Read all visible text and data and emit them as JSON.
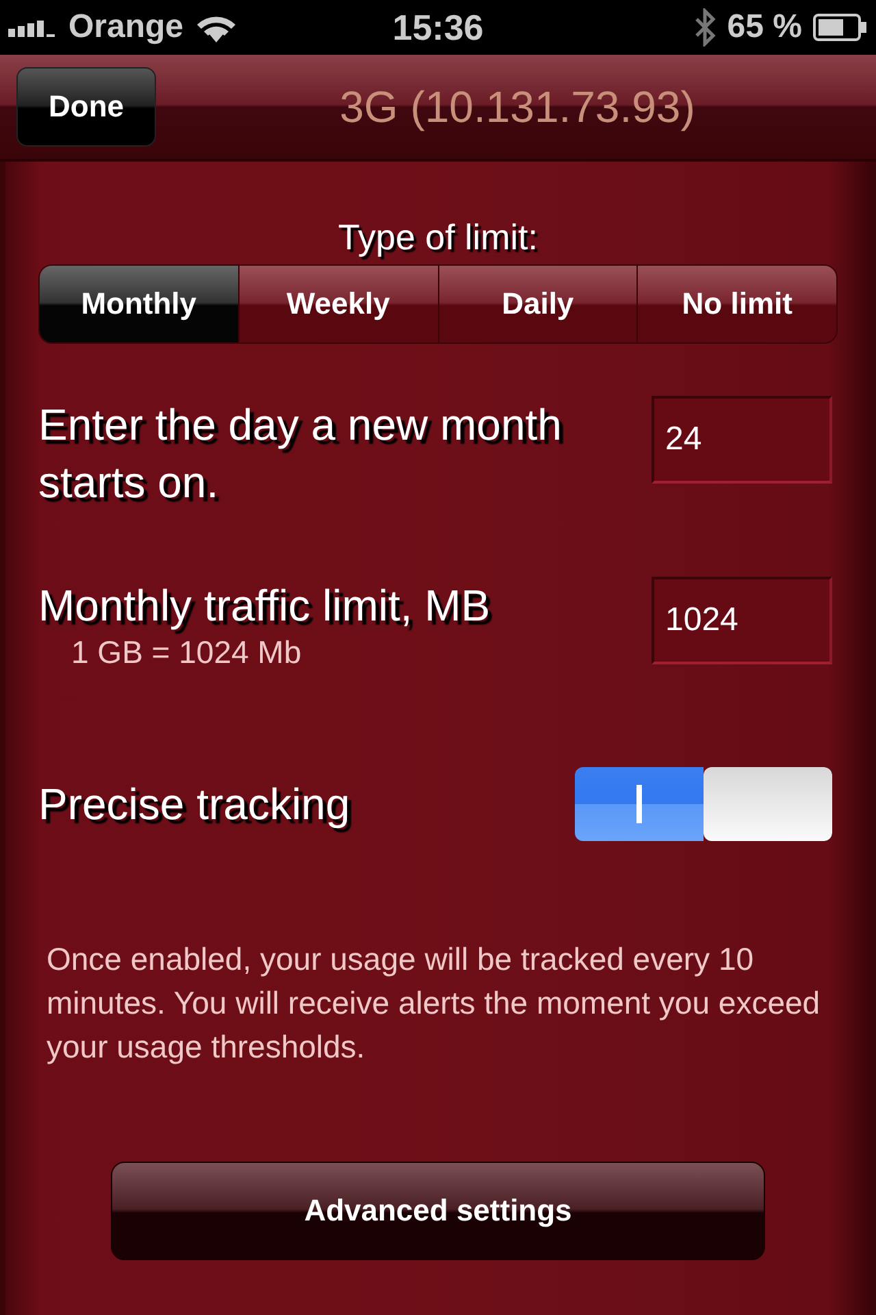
{
  "status_bar": {
    "carrier": "Orange",
    "time": "15:36",
    "battery": "65 %"
  },
  "nav_bar": {
    "done_button": "Done",
    "title": "3G (10.131.73.93)"
  },
  "limit_type": {
    "label": "Type of limit:",
    "segments": [
      {
        "label": "Monthly",
        "selected": true
      },
      {
        "label": "Weekly",
        "selected": false
      },
      {
        "label": "Daily",
        "selected": false
      },
      {
        "label": "No limit",
        "selected": false
      }
    ]
  },
  "fields": [
    {
      "label": "Enter the day a new month starts on.",
      "value": "24"
    },
    {
      "label": "Monthly traffic limit, MB",
      "note": "1 GB = 1024 Mb",
      "value": "1024"
    }
  ],
  "precise_tracking": {
    "label": "Precise tracking",
    "on": true,
    "description": "Once enabled, your usage will be tracked every 10 minutes. You will receive alerts the moment you exceed your usage thresholds."
  },
  "advanced_button": "Advanced settings"
}
